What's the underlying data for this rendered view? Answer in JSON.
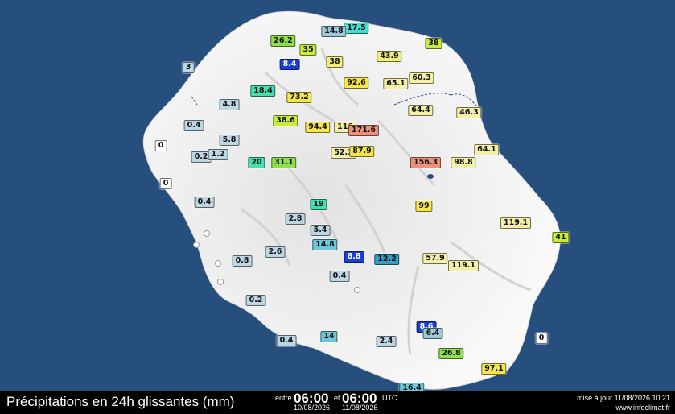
{
  "footer": {
    "title": "Précipitations en 24h glissantes (mm)",
    "between_label": "entre",
    "start_time": "06:00",
    "and_label": "et",
    "end_time": "06:00",
    "utc_label": "UTC",
    "start_date": "10/08/2026",
    "end_date": "11/08/2026",
    "updated": "mise à jour 11/08/2026 10:21",
    "site": "www.infoclimat.fr"
  },
  "stations": [
    {
      "v": "17.5",
      "c": "#40e0d0"
    },
    {
      "v": "14.8",
      "c": "#9ec8d8"
    },
    {
      "v": "26.2",
      "c": "#8ee04a"
    },
    {
      "v": "35",
      "c": "#c8ec3c"
    },
    {
      "v": "38",
      "c": "#c8ec3c"
    },
    {
      "v": "8.4",
      "c": "#1a3fd8"
    },
    {
      "v": "3",
      "c": "#bcd6e2"
    },
    {
      "v": "43.9",
      "c": "#f0f07a"
    },
    {
      "v": "38",
      "c": "#f0f07a"
    },
    {
      "v": "92.6",
      "c": "#f5e64a"
    },
    {
      "v": "65.1",
      "c": "#f3f0a8"
    },
    {
      "v": "60.3",
      "c": "#f3f0a8"
    },
    {
      "v": "18.4",
      "c": "#40e0b0"
    },
    {
      "v": "73.2",
      "c": "#f5e64a"
    },
    {
      "v": "4.8",
      "c": "#bcd6e2"
    },
    {
      "v": "64.4",
      "c": "#f3f0a8"
    },
    {
      "v": "46.3",
      "c": "#f3f0a8"
    },
    {
      "v": "0.4",
      "c": "#bcd6e2"
    },
    {
      "v": "38.6",
      "c": "#c8ec3c"
    },
    {
      "v": "94.4",
      "c": "#f5e64a"
    },
    {
      "v": "116",
      "c": "#f3f0a8"
    },
    {
      "v": "171.6",
      "c": "#f0907a"
    },
    {
      "v": "5.8",
      "c": "#bcd6e2"
    },
    {
      "v": "0",
      "c": "#ffffff"
    },
    {
      "v": "0.2",
      "c": "#bcd6e2"
    },
    {
      "v": "1.2",
      "c": "#bcd6e2"
    },
    {
      "v": "52.2",
      "c": "#f3f0a8"
    },
    {
      "v": "87.9",
      "c": "#f5e64a"
    },
    {
      "v": "64.1",
      "c": "#f3f0a8"
    },
    {
      "v": "20",
      "c": "#40e0b0"
    },
    {
      "v": "31.1",
      "c": "#8ee04a"
    },
    {
      "v": "156.3",
      "c": "#f0907a"
    },
    {
      "v": "98.8",
      "c": "#f3f0a8"
    },
    {
      "v": "0",
      "c": "#ffffff"
    },
    {
      "v": "0.4",
      "c": "#bcd6e2"
    },
    {
      "v": "19",
      "c": "#40e0b0"
    },
    {
      "v": "99",
      "c": "#f5e64a"
    },
    {
      "v": "2.8",
      "c": "#bcd6e2"
    },
    {
      "v": "119.1",
      "c": "#f3f0a8"
    },
    {
      "v": "5.4",
      "c": "#bcd6e2"
    },
    {
      "v": "41",
      "c": "#c8ec3c"
    },
    {
      "v": "14.8",
      "c": "#6cc8d8"
    },
    {
      "v": "2.6",
      "c": "#bcd6e2"
    },
    {
      "v": "0.8",
      "c": "#bcd6e2"
    },
    {
      "v": "8.8",
      "c": "#1a3fd8"
    },
    {
      "v": "12.2",
      "c": "#30a0c8"
    },
    {
      "v": "57.9",
      "c": "#f3f0a8"
    },
    {
      "v": "119.1",
      "c": "#f3f0a8"
    },
    {
      "v": "0.4",
      "c": "#bcd6e2"
    },
    {
      "v": "0.2",
      "c": "#bcd6e2"
    },
    {
      "v": "8.6",
      "c": "#1a3fd8"
    },
    {
      "v": "6.4",
      "c": "#9ec8d8"
    },
    {
      "v": "14",
      "c": "#6cc8d8"
    },
    {
      "v": "0.4",
      "c": "#bcd6e2"
    },
    {
      "v": "2.4",
      "c": "#bcd6e2"
    },
    {
      "v": "0",
      "c": "#ffffff"
    },
    {
      "v": "26.8",
      "c": "#8ee04a"
    },
    {
      "v": "97.1",
      "c": "#f5e64a"
    },
    {
      "v": "16.4",
      "c": "#6cc8d8"
    }
  ]
}
